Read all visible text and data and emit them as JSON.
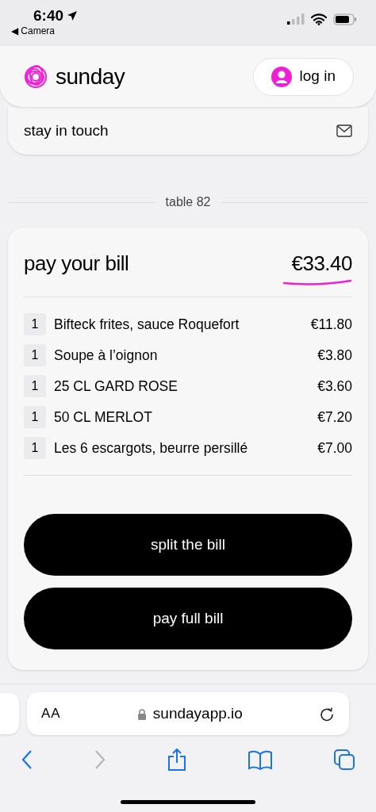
{
  "status_bar": {
    "time": "6:40",
    "back_app": "◀ Camera"
  },
  "header": {
    "brand": "sunday",
    "login_button": "log in"
  },
  "stay_in_touch": {
    "label": "stay in touch"
  },
  "table_label": "table 82",
  "bill": {
    "title": "pay your bill",
    "total": "€33.40",
    "items": [
      {
        "qty": "1",
        "name": "Bifteck frites, sauce Roquefort",
        "price": "€11.80"
      },
      {
        "qty": "1",
        "name": "Soupe à l’oignon",
        "price": "€3.80"
      },
      {
        "qty": "1",
        "name": "25 CL GARD ROSE",
        "price": "€3.60"
      },
      {
        "qty": "1",
        "name": "50 CL MERLOT",
        "price": "€7.20"
      },
      {
        "qty": "1",
        "name": "Les 6 escargots, beurre persillé",
        "price": "€7.00"
      }
    ],
    "buttons": [
      "split the bill",
      "pay full bill"
    ]
  },
  "browser": {
    "text_size": "AA",
    "url": "sundayapp.io",
    "forward_disabled": true
  }
}
